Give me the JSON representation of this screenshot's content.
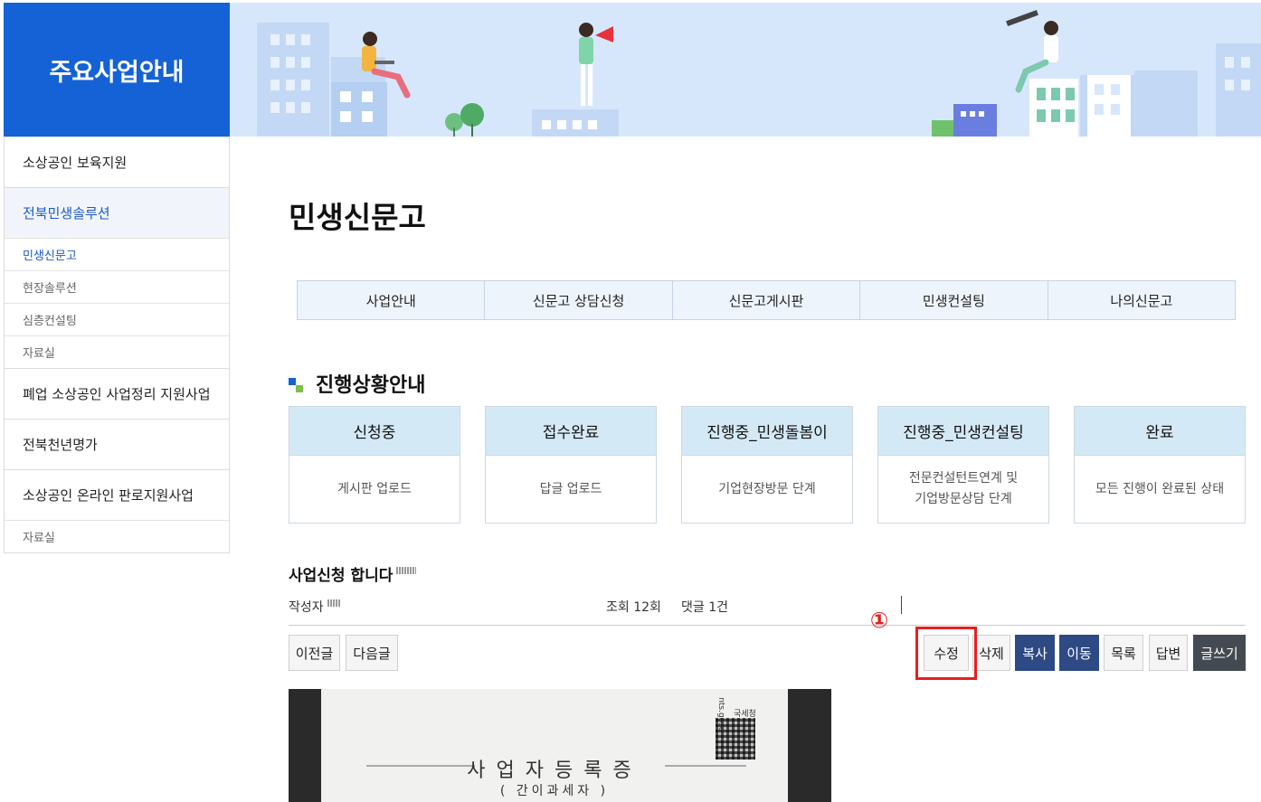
{
  "sidebar": {
    "title": "주요사업안내",
    "items": [
      {
        "label": "소상공인 보육지원"
      },
      {
        "label": "전북민생솔루션"
      },
      {
        "label": "민생신문고"
      },
      {
        "label": "현장솔루션"
      },
      {
        "label": "심층컨설팅"
      },
      {
        "label": "자료실"
      },
      {
        "label": "폐업 소상공인 사업정리 지원사업"
      },
      {
        "label": "전북천년명가"
      },
      {
        "label": "소상공인 온라인 판로지원사업"
      },
      {
        "label": "자료실"
      }
    ]
  },
  "page": {
    "title": "민생신문고"
  },
  "tabs": [
    {
      "label": "사업안내"
    },
    {
      "label": "신문고 상담신청"
    },
    {
      "label": "신문고게시판"
    },
    {
      "label": "민생컨설팅"
    },
    {
      "label": "나의신문고"
    }
  ],
  "progress_section": {
    "heading": "진행상황안내",
    "steps": [
      {
        "title": "신청중",
        "desc": "게시판 업로드"
      },
      {
        "title": "접수완료",
        "desc": "답글 업로드"
      },
      {
        "title": "진행중_민생돌봄이",
        "desc": "기업현장방문 단계"
      },
      {
        "title": "진행중_민생컨설팅",
        "desc_line1": "전문컨설턴트연계 및",
        "desc_line2": "기업방문상담 단계"
      },
      {
        "title": "완료",
        "desc": "모든 진행이 완료된 상태"
      }
    ]
  },
  "post": {
    "title": "사업신청 합니다",
    "author_label": "작성자",
    "views": "조회 12회",
    "comments": "댓글 1건"
  },
  "buttons": {
    "prev": "이전글",
    "next": "다음글",
    "edit": "수정",
    "delete": "삭제",
    "copy": "복사",
    "move": "이동",
    "list": "목록",
    "reply": "답변",
    "write": "글쓰기"
  },
  "annotation": {
    "marker": "①",
    "color": "#e5201f"
  },
  "attachment": {
    "doc_title": "사업자등록증",
    "doc_subtitle": "( 간이과세자 )",
    "qr_label": "국세청",
    "site": "nts.go.kr"
  },
  "colors": {
    "brand_blue": "#1462d6",
    "tab_bg": "#eef4fb",
    "status_head_bg": "#d4e9f6",
    "navy_button": "#2d4a85",
    "dark_button": "#444a52",
    "accent_green": "#7cc14a"
  }
}
